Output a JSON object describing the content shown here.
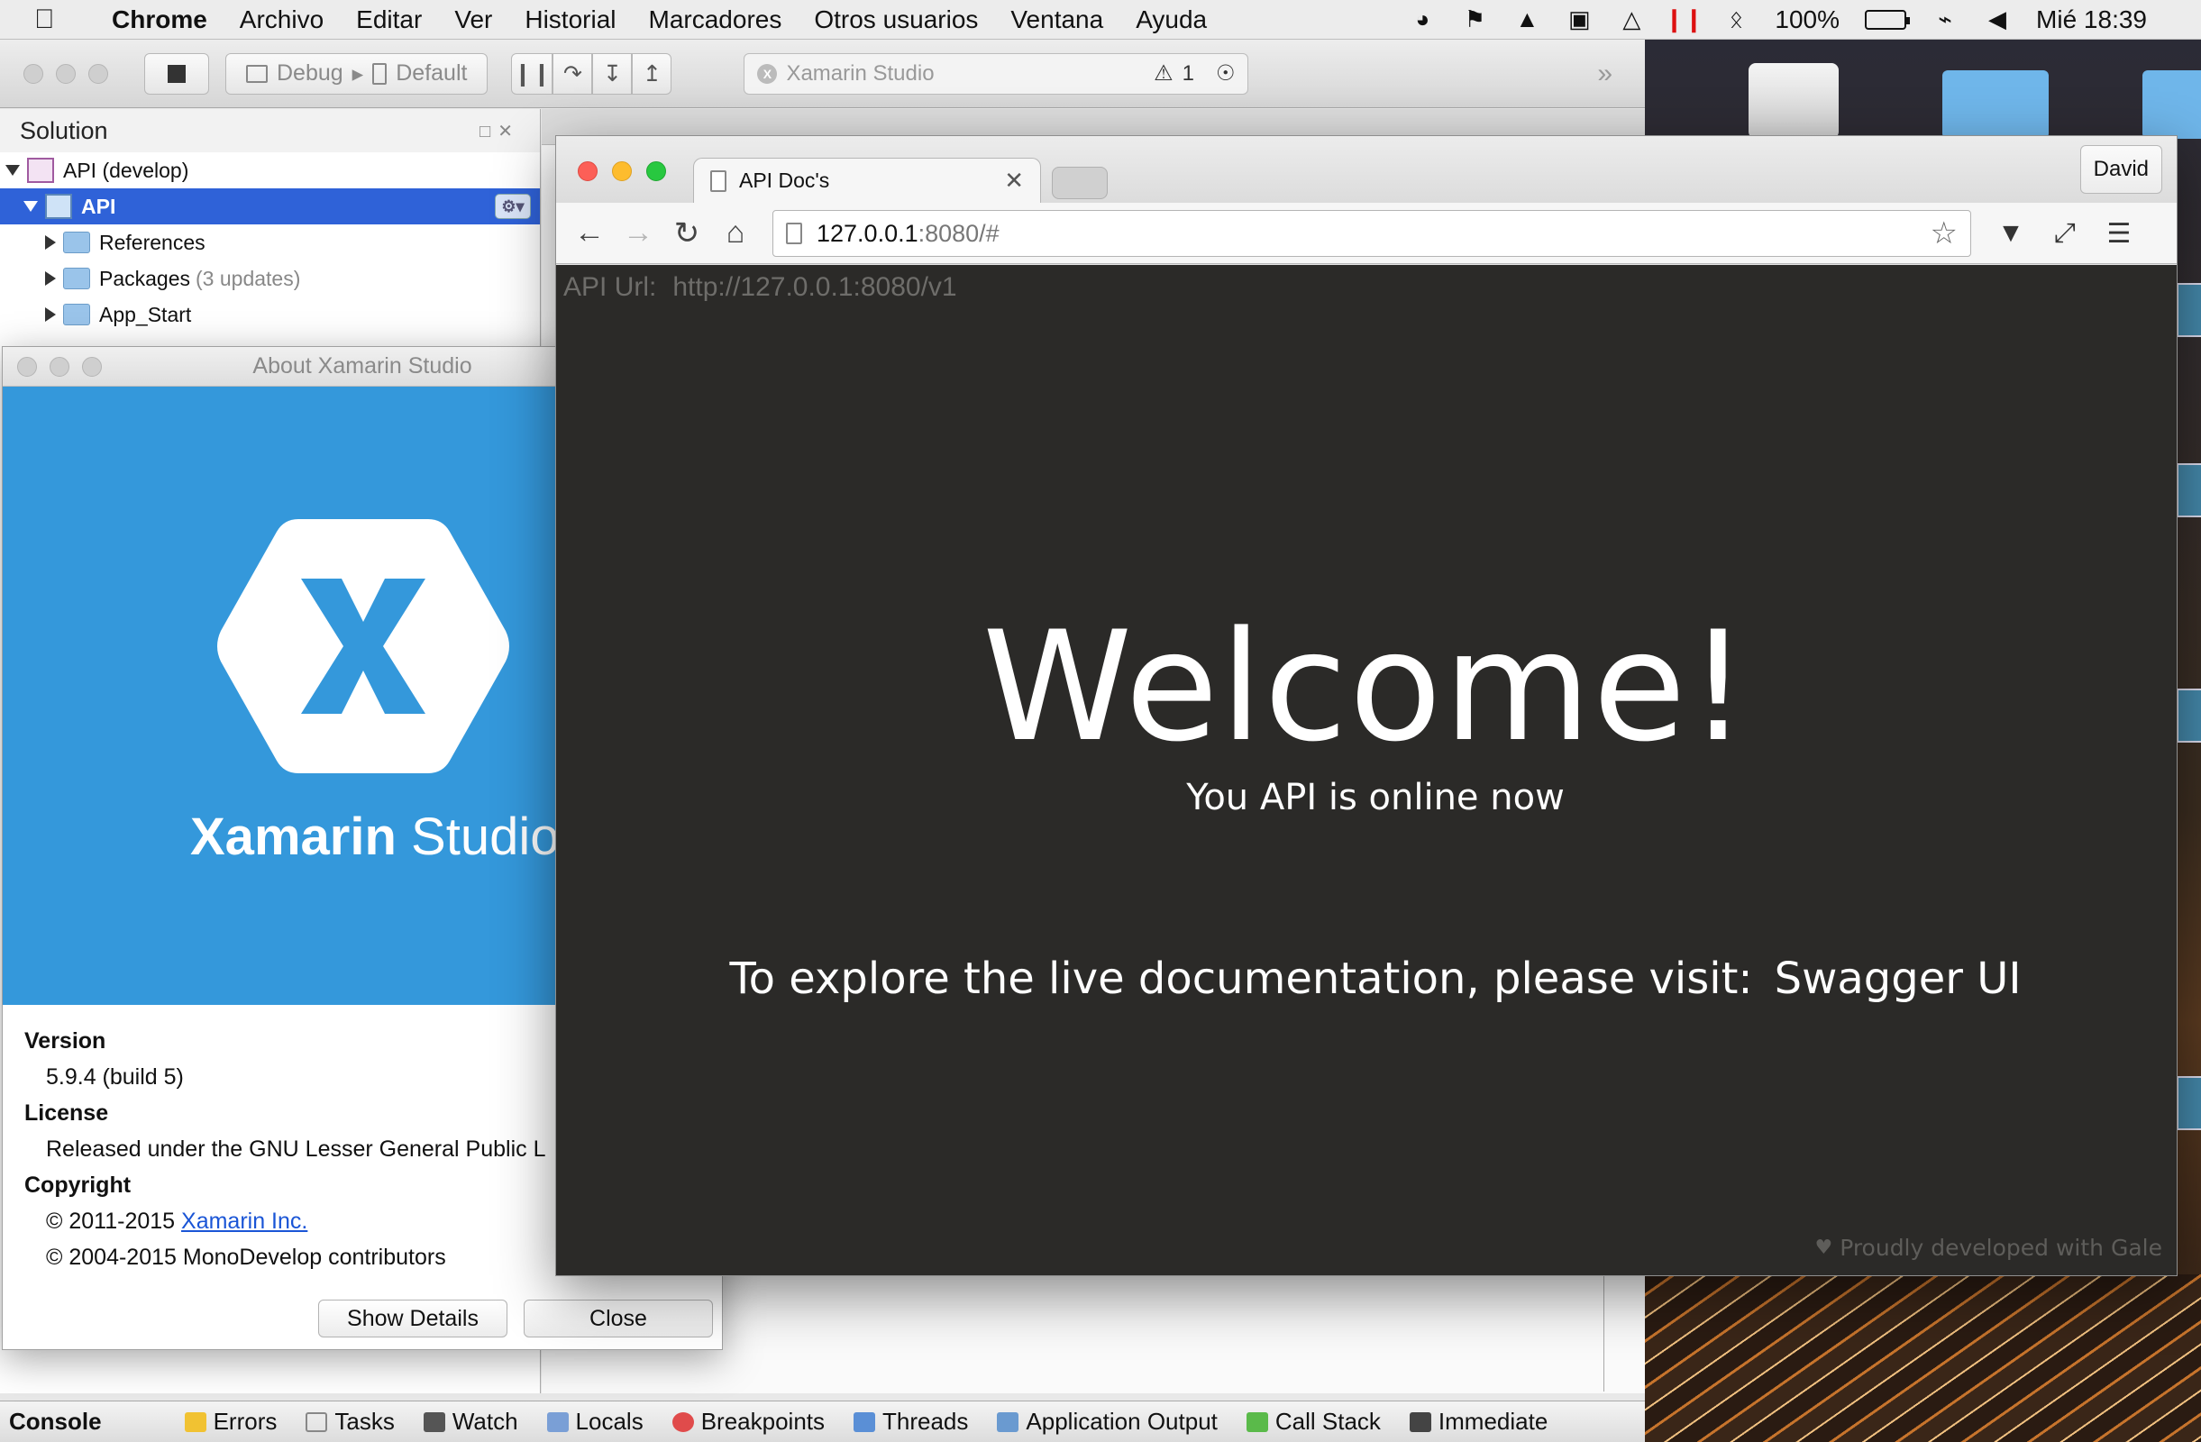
{
  "menubar": {
    "app_name": "Chrome",
    "items": [
      "Archivo",
      "Editar",
      "Ver",
      "Historial",
      "Marcadores",
      "Otros usuarios",
      "Ventana",
      "Ayuda"
    ],
    "battery": "100%",
    "clock": "Mié 18:39"
  },
  "ide": {
    "run_config": "Debug",
    "device": "Default",
    "status_title": "Xamarin Studio",
    "warnings": "1",
    "solution": {
      "title": "Solution",
      "root": "API (develop)",
      "project": "API",
      "children": [
        {
          "label": "References",
          "extra": ""
        },
        {
          "label": "Packages",
          "extra": "(3 updates)"
        },
        {
          "label": "App_Start",
          "extra": ""
        }
      ]
    },
    "pads": [
      "Console",
      "Errors",
      "Tasks",
      "Watch",
      "Locals",
      "Breakpoints",
      "Threads",
      "Application Output",
      "Call Stack",
      "Immediate"
    ]
  },
  "about": {
    "title": "About Xamarin Studio",
    "product_a": "Xamarin",
    "product_b": "Studio",
    "version_label": "Version",
    "version": "5.9.4 (build 5)",
    "license_label": "License",
    "license": "Released under the GNU Lesser General Public L",
    "copyright_label": "Copyright",
    "copyright_1_prefix": "© 2011-2015 ",
    "copyright_1_link": "Xamarin Inc.",
    "copyright_2": "© 2004-2015 MonoDevelop contributors",
    "show_details": "Show Details",
    "close": "Close",
    "accent": "#3498db"
  },
  "chrome": {
    "tab_title": "API Doc's",
    "profile": "David",
    "url_host": "127.0.0.1",
    "url_rest": ":8080/#",
    "page": {
      "api_url_label": "API Url:",
      "api_url": "http://127.0.0.1:8080/v1",
      "welcome": "Welcome!",
      "subtitle": "You API is online now",
      "explore": "To explore the live documentation, please visit:",
      "swagger_link": "Swagger UI",
      "footer": "Proudly developed with Gale",
      "background": "#2b2a28"
    }
  }
}
